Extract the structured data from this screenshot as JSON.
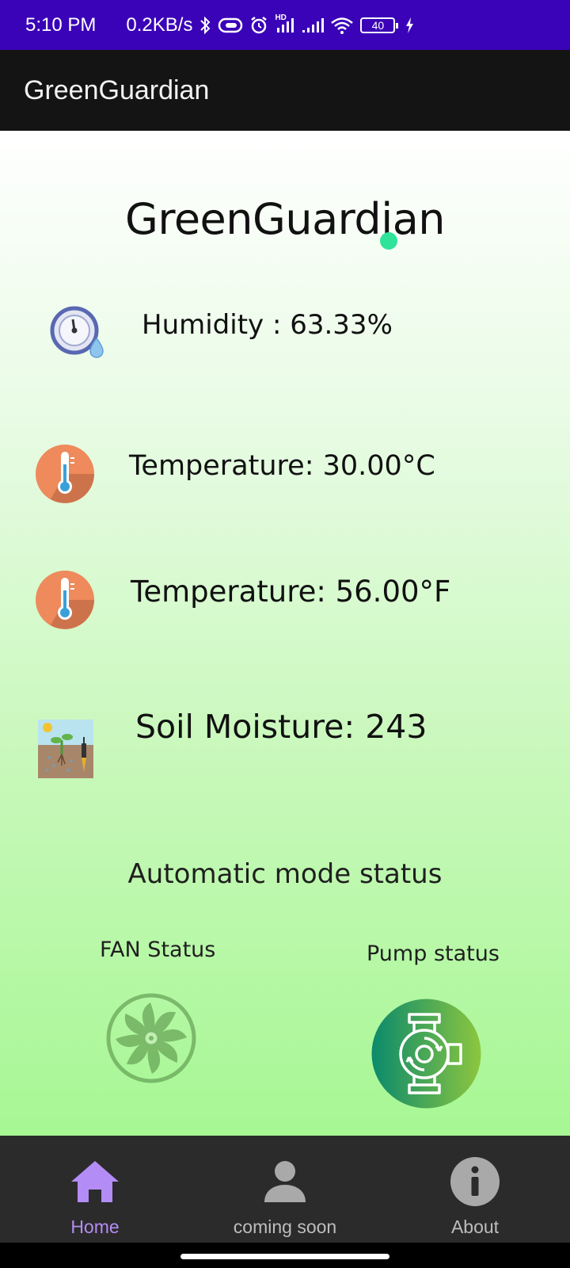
{
  "status_bar": {
    "time": "5:10 PM",
    "network_speed": "0.2KB/s",
    "battery_level": "40",
    "hd_label": "HD",
    "icons": [
      "bluetooth-icon",
      "cast-icon",
      "alarm-icon",
      "signal-icon",
      "signal-icon",
      "wifi-icon",
      "battery-icon",
      "charging-icon"
    ]
  },
  "app_bar": {
    "title": "GreenGuardian"
  },
  "main": {
    "title": "GreenGuardian",
    "readings": [
      {
        "label": "Humidity : 63.33%",
        "icon": "humidity-gauge-icon"
      },
      {
        "label": "Temperature:  30.00°C",
        "icon": "thermometer-icon"
      },
      {
        "label": "Temperature: 56.00°F",
        "icon": "thermometer-icon"
      },
      {
        "label": "Soil Moisture: 243",
        "icon": "soil-moisture-icon"
      }
    ],
    "automatic_mode": {
      "title": "Automatic mode status",
      "fan_label": "FAN Status",
      "pump_label": "Pump status",
      "fan_icon": "fan-icon",
      "pump_icon": "pump-icon"
    }
  },
  "bottom_nav": {
    "items": [
      {
        "label": "Home",
        "icon": "home-icon",
        "active": true
      },
      {
        "label": "coming soon",
        "icon": "person-icon",
        "active": false
      },
      {
        "label": "About",
        "icon": "info-icon",
        "active": false
      }
    ]
  },
  "colors": {
    "status_bar": "#3a03b8",
    "app_bar": "#141414",
    "nav_active": "#b48cf5",
    "thermometer_circle": "#ee8a5b",
    "pump_gradient_start": "#0b8a6c",
    "pump_gradient_end": "#8cc63f"
  }
}
